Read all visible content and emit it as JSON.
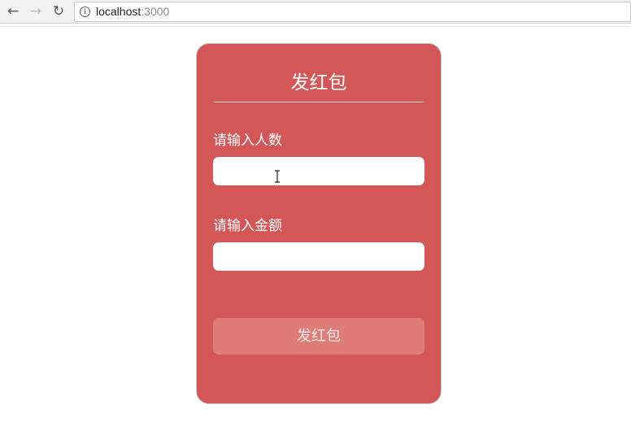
{
  "browser": {
    "back_icon": "arrow-left-icon",
    "forward_icon": "arrow-right-icon",
    "reload_icon": "reload-icon",
    "back_glyph": "←",
    "forward_glyph": "→",
    "reload_glyph": "↻",
    "info_glyph": "i",
    "url_host": "localhost",
    "url_port": ":3000"
  },
  "form": {
    "title": "发红包",
    "count_label": "请输入人数",
    "count_value": "",
    "amount_label": "请输入金额",
    "amount_value": "",
    "submit_label": "发红包"
  },
  "colors": {
    "card_background": "#d45757",
    "button_background": "#e07c78",
    "text": "#ffffff"
  }
}
